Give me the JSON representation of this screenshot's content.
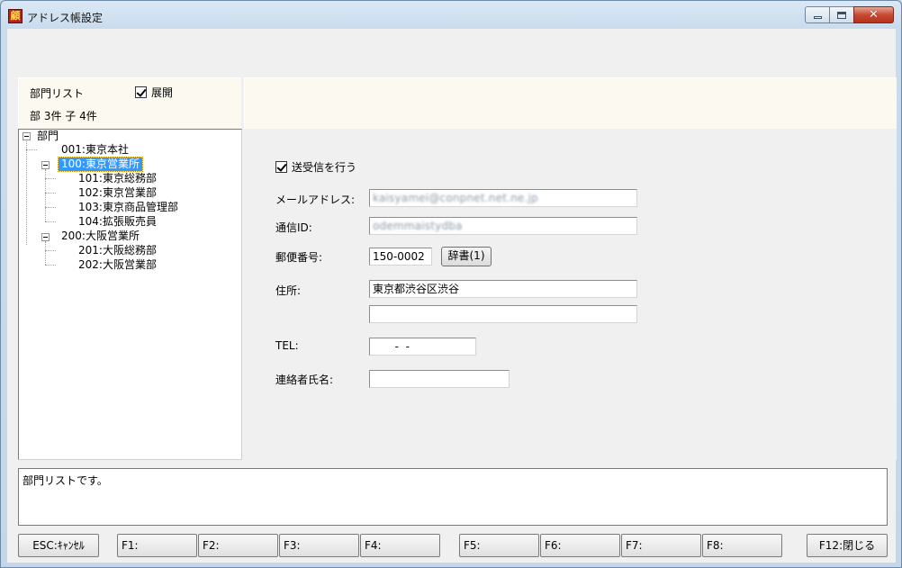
{
  "window": {
    "title": "アドレス帳設定",
    "icon": "app-logo-icon",
    "controls": [
      "minimize-icon",
      "maximize-icon",
      "close-icon"
    ]
  },
  "dept_panel": {
    "title": "部門リスト",
    "expand_label": "展開",
    "expand_checked": true,
    "count_text": "部 3件 子 4件"
  },
  "tree": {
    "root": "部門",
    "nodes": [
      {
        "label": "001:東京本社",
        "level": 1,
        "selected": false
      },
      {
        "label": "100:東京営業所",
        "level": 1,
        "selected": true
      },
      {
        "label": "101:東京総務部",
        "level": 2,
        "selected": false
      },
      {
        "label": "102:東京営業部",
        "level": 2,
        "selected": false
      },
      {
        "label": "103:東京商品管理部",
        "level": 2,
        "selected": false
      },
      {
        "label": "104:拡張販売員",
        "level": 2,
        "selected": false
      },
      {
        "label": "200:大阪営業所",
        "level": 1,
        "selected": false
      },
      {
        "label": "201:大阪総務部",
        "level": 2,
        "selected": false
      },
      {
        "label": "202:大阪営業部",
        "level": 2,
        "selected": false
      }
    ]
  },
  "form": {
    "send_receive_label": "送受信を行う",
    "send_receive_checked": true,
    "mail_label": "メールアドレス:",
    "mail_value": "kaisyamei@conpnet.net.ne.jp",
    "comm_id_label": "通信ID:",
    "comm_id_value": "odemmaistydba",
    "postal_label": "郵便番号:",
    "postal_value": "150-0002",
    "dict_button": "辞書(1)",
    "address_label": "住所:",
    "address1_value": "東京都渋谷区渋谷",
    "address2_value": "",
    "tel_label": "TEL:",
    "tel_value": "  -  -",
    "contact_label": "連絡者氏名:",
    "contact_value": ""
  },
  "status": {
    "message": "部門リストです。"
  },
  "fkeys": {
    "esc": "ESC:ｷｬﾝｾﾙ",
    "f1": "F1:",
    "f2": "F2:",
    "f3": "F3:",
    "f4": "F4:",
    "f5": "F5:",
    "f6": "F6:",
    "f7": "F7:",
    "f8": "F8:",
    "f12": "F12:閉じる"
  }
}
